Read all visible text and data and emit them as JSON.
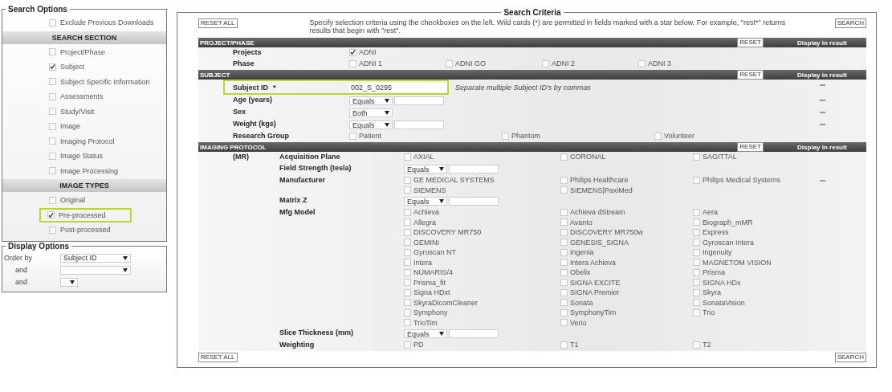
{
  "search_options": {
    "title": "Search Options",
    "items": [
      {
        "kind": "checkbox",
        "label": "Exclude Previous Downloads",
        "checked": false,
        "highlighted": false
      },
      {
        "kind": "header",
        "label": "SEARCH SECTION"
      },
      {
        "kind": "checkbox",
        "label": "Project/Phase",
        "checked": false,
        "highlighted": false
      },
      {
        "kind": "checkbox",
        "label": "Subject",
        "checked": true,
        "highlighted": false
      },
      {
        "kind": "checkbox",
        "label": "Subject Specific Information",
        "checked": false,
        "highlighted": false
      },
      {
        "kind": "checkbox",
        "label": "Assessments",
        "checked": false,
        "highlighted": false
      },
      {
        "kind": "checkbox",
        "label": "Study/Visit",
        "checked": false,
        "highlighted": false
      },
      {
        "kind": "checkbox",
        "label": "Image",
        "checked": false,
        "highlighted": false
      },
      {
        "kind": "checkbox",
        "label": "Imaging Protocol",
        "checked": false,
        "highlighted": false
      },
      {
        "kind": "checkbox",
        "label": "Image Status",
        "checked": false,
        "highlighted": false
      },
      {
        "kind": "checkbox",
        "label": "Image Processing",
        "checked": false,
        "highlighted": false
      },
      {
        "kind": "header",
        "label": "IMAGE TYPES"
      },
      {
        "kind": "checkbox",
        "label": "Original",
        "checked": false,
        "highlighted": false
      },
      {
        "kind": "checkbox",
        "label": "Pre-processed",
        "checked": true,
        "highlighted": true
      },
      {
        "kind": "checkbox",
        "label": "Post-processed",
        "checked": false,
        "highlighted": false
      }
    ]
  },
  "display_options": {
    "title": "Display Options",
    "rows": [
      {
        "label": "Order by",
        "kind": "wide",
        "value": "Subject ID"
      },
      {
        "label": "and",
        "kind": "wide"
      },
      {
        "label": "and",
        "kind": "narrow"
      }
    ]
  },
  "search_criteria": {
    "title": "Search Criteria",
    "reset_all": "RESET ALL",
    "instructions": "Specify selection criteria using the checkboxes on the left. Wild cards (*) are permitted in fields marked with a star below. For example, \"rest*\" returns results that begin with \"rest\".",
    "search": "SEARCH",
    "sections": [
      {
        "title": "PROJECT/PHASE",
        "reset": "RESET",
        "display_heading": "Display in result",
        "rows": [
          {
            "kind": "options",
            "label": "Projects",
            "options": [
              {
                "label": "ADNI",
                "checked": true
              }
            ]
          },
          {
            "kind": "options",
            "label": "Phase",
            "options": [
              {
                "label": "ADNI 1",
                "checked": false
              },
              {
                "label": "ADNI GO",
                "checked": false
              },
              {
                "label": "ADNI 2",
                "checked": false
              },
              {
                "label": "ADNI 3",
                "checked": false
              }
            ]
          }
        ]
      },
      {
        "title": "SUBJECT",
        "reset": "RESET",
        "display_heading": "Display in result",
        "rows": [
          {
            "kind": "text",
            "label": "Subject ID",
            "star": "*",
            "value": "002_S_0295",
            "note": "Separate multiple Subject ID's by commas",
            "highlighted": true,
            "display_option": true
          },
          {
            "kind": "select_input",
            "label": "Age (years)",
            "select": "Equals",
            "display_option": true
          },
          {
            "kind": "select",
            "label": "Sex",
            "select": "Both",
            "display_option": true
          },
          {
            "kind": "select_input",
            "label": "Weight (kgs)",
            "select": "Equals",
            "display_option": true
          },
          {
            "kind": "options",
            "label": "Research Group",
            "options": [
              {
                "label": "Patient",
                "checked": false
              },
              {
                "label": "Phantom",
                "checked": false
              },
              {
                "label": "Volunteer",
                "checked": false
              }
            ]
          }
        ]
      },
      {
        "title": "IMAGING PROTOCOL",
        "reset": "RESET",
        "display_heading": "Display in result",
        "group": "(MR)",
        "rows": [
          {
            "kind": "options",
            "label": "Acquisition Plane",
            "options": [
              {
                "label": "AXIAL",
                "checked": false
              },
              {
                "label": "CORONAL",
                "checked": false
              },
              {
                "label": "SAGITTAL",
                "checked": false
              }
            ]
          },
          {
            "kind": "select_input",
            "label": "Field Strength (tesla)",
            "select": "Equals"
          },
          {
            "kind": "options",
            "label": "Manufacturer",
            "display_option": true,
            "options": [
              {
                "label": "GE MEDICAL SYSTEMS",
                "checked": false
              },
              {
                "label": "Philips Healthcare",
                "checked": false
              },
              {
                "label": "Philips Medical Systems",
                "checked": false
              },
              {
                "label": "SIEMENS",
                "checked": false
              },
              {
                "label": "SIEMENS|PaxiMed",
                "checked": false
              }
            ]
          },
          {
            "kind": "select_input",
            "label": "Matrix Z",
            "select": "Equals"
          },
          {
            "kind": "options",
            "label": "Mfg Model",
            "options": [
              {
                "label": "Achieva",
                "checked": false
              },
              {
                "label": "Achieva dStream",
                "checked": false
              },
              {
                "label": "Aera",
                "checked": false
              },
              {
                "label": "Allegra",
                "checked": false
              },
              {
                "label": "Avanto",
                "checked": false
              },
              {
                "label": "Biograph_mMR",
                "checked": false
              },
              {
                "label": "DISCOVERY MR750",
                "checked": false
              },
              {
                "label": "DISCOVERY MR750w",
                "checked": false
              },
              {
                "label": "Express",
                "checked": false
              },
              {
                "label": "GEMINI",
                "checked": false
              },
              {
                "label": "GENESIS_SIGNA",
                "checked": false
              },
              {
                "label": "Gyroscan Intera",
                "checked": false
              },
              {
                "label": "Gyroscan NT",
                "checked": false
              },
              {
                "label": "Ingenia",
                "checked": false
              },
              {
                "label": "Ingenuity",
                "checked": false
              },
              {
                "label": "Intera",
                "checked": false
              },
              {
                "label": "Intera Achieva",
                "checked": false
              },
              {
                "label": "MAGNETOM VISION",
                "checked": false
              },
              {
                "label": "NUMARIS/4",
                "checked": false
              },
              {
                "label": "Obelix",
                "checked": false
              },
              {
                "label": "Prisma",
                "checked": false
              },
              {
                "label": "Prisma_fit",
                "checked": false
              },
              {
                "label": "SIGNA EXCITE",
                "checked": false
              },
              {
                "label": "SIGNA HDx",
                "checked": false
              },
              {
                "label": "Signa HDxt",
                "checked": false
              },
              {
                "label": "SIGNA Premier",
                "checked": false
              },
              {
                "label": "Skyra",
                "checked": false
              },
              {
                "label": "SkyraDicomCleaner",
                "checked": false
              },
              {
                "label": "Sonata",
                "checked": false
              },
              {
                "label": "SonataVision",
                "checked": false
              },
              {
                "label": "Symphony",
                "checked": false
              },
              {
                "label": "SymphonyTim",
                "checked": false
              },
              {
                "label": "Trio",
                "checked": false
              },
              {
                "label": "TrioTim",
                "checked": false
              },
              {
                "label": "Verio",
                "checked": false
              }
            ]
          },
          {
            "kind": "select_input",
            "label": "Slice Thickness (mm)",
            "select": "Equals"
          },
          {
            "kind": "options",
            "label": "Weighting",
            "options": [
              {
                "label": "PD",
                "checked": false
              },
              {
                "label": "T1",
                "checked": false
              },
              {
                "label": "T2",
                "checked": false
              }
            ]
          }
        ]
      }
    ],
    "footer": {
      "reset_all": "RESET ALL",
      "search": "SEARCH"
    }
  }
}
